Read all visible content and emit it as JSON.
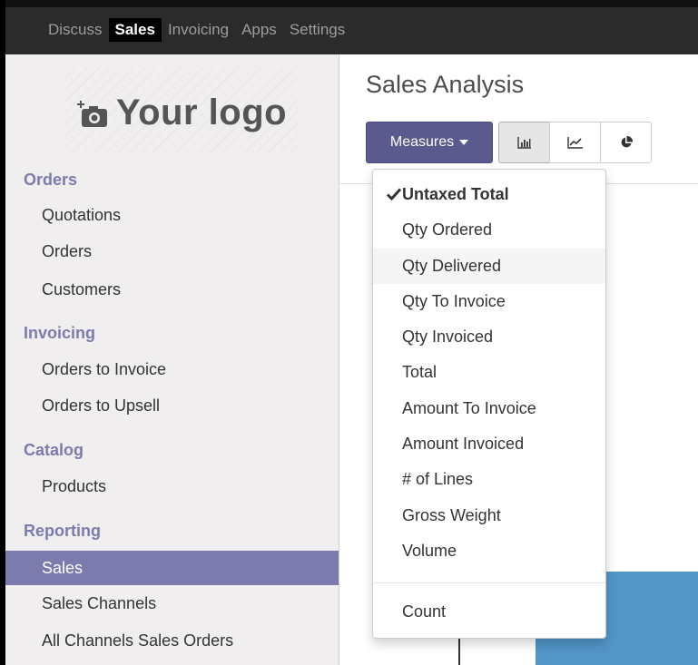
{
  "topnav": {
    "items": [
      "Discuss",
      "Sales",
      "Invoicing",
      "Apps",
      "Settings"
    ],
    "active": "Sales"
  },
  "logo": {
    "text": "Your logo",
    "icon": "camera-icon"
  },
  "sidebar": {
    "sections": [
      {
        "title": "Orders",
        "items": [
          "Quotations",
          "Orders",
          "Customers"
        ]
      },
      {
        "title": "Invoicing",
        "items": [
          "Orders to Invoice",
          "Orders to Upsell"
        ]
      },
      {
        "title": "Catalog",
        "items": [
          "Products"
        ]
      },
      {
        "title": "Reporting",
        "items": [
          "Sales",
          "Sales Channels",
          "All Channels Sales Orders"
        ]
      }
    ],
    "active_item": "Sales"
  },
  "main": {
    "title": "Sales Analysis",
    "measures_label": "Measures",
    "view_buttons": [
      {
        "name": "bar-chart-icon",
        "active": true
      },
      {
        "name": "line-chart-icon",
        "active": false
      },
      {
        "name": "pie-chart-icon",
        "active": false
      }
    ]
  },
  "measures_dropdown": {
    "items": [
      "Untaxed Total",
      "Qty Ordered",
      "Qty Delivered",
      "Qty To Invoice",
      "Qty Invoiced",
      "Total",
      "Amount To Invoice",
      "Amount Invoiced",
      "# of Lines",
      "Gross Weight",
      "Volume"
    ],
    "selected": "Untaxed Total",
    "hovered": "Qty Delivered",
    "count_label": "Count"
  },
  "colors": {
    "accent": "#7c7bad",
    "button_primary": "#5b5a8e",
    "navbar": "#2b2b2b",
    "sidebar_bg": "#f0eeee",
    "chart_bar": "#5295c7"
  }
}
